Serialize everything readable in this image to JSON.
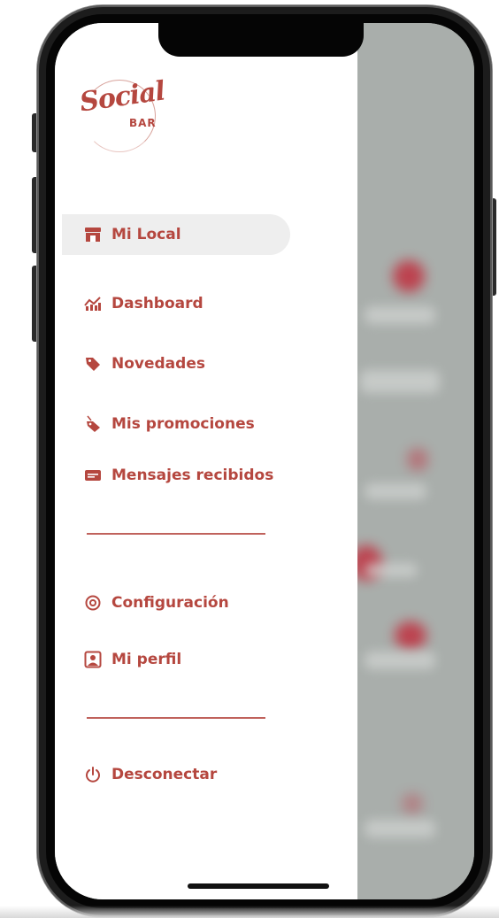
{
  "app": {
    "logo_text": "Social",
    "logo_sub": "BAR"
  },
  "menu": {
    "items": [
      {
        "label": "Mi Local",
        "icon": "store-icon",
        "active": true
      },
      {
        "label": "Dashboard",
        "icon": "chart-icon",
        "active": false
      },
      {
        "label": "Novedades",
        "icon": "tag-icon",
        "active": false
      },
      {
        "label": "Mis promociones",
        "icon": "price-tag-icon",
        "active": false
      },
      {
        "label": "Mensajes recibidos",
        "icon": "message-icon",
        "active": false
      }
    ],
    "secondary": [
      {
        "label": "Configuración",
        "icon": "settings-icon"
      },
      {
        "label": "Mi perfil",
        "icon": "profile-icon"
      }
    ],
    "logout": {
      "label": "Desconectar",
      "icon": "power-icon"
    }
  },
  "colors": {
    "accent": "#b5473f",
    "active_bg": "#eeeeee",
    "overlay": "#a9aeab",
    "frame": "#1c1c1c"
  }
}
